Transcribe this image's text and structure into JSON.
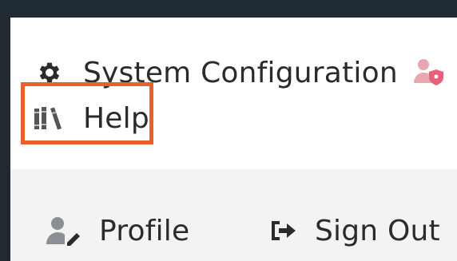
{
  "menu": {
    "items": [
      {
        "label": "System Configuration",
        "icon": "gear-icon"
      },
      {
        "label": "Help",
        "icon": "books-icon"
      }
    ],
    "footer": [
      {
        "label": "Profile",
        "icon": "user-edit-icon"
      },
      {
        "label": "Sign Out",
        "icon": "sign-out-icon"
      }
    ]
  },
  "colors": {
    "highlight": "#e8602a",
    "text": "#2b2b2b",
    "border": "#1f2a33",
    "user_shield_icon": "#e8607a"
  }
}
